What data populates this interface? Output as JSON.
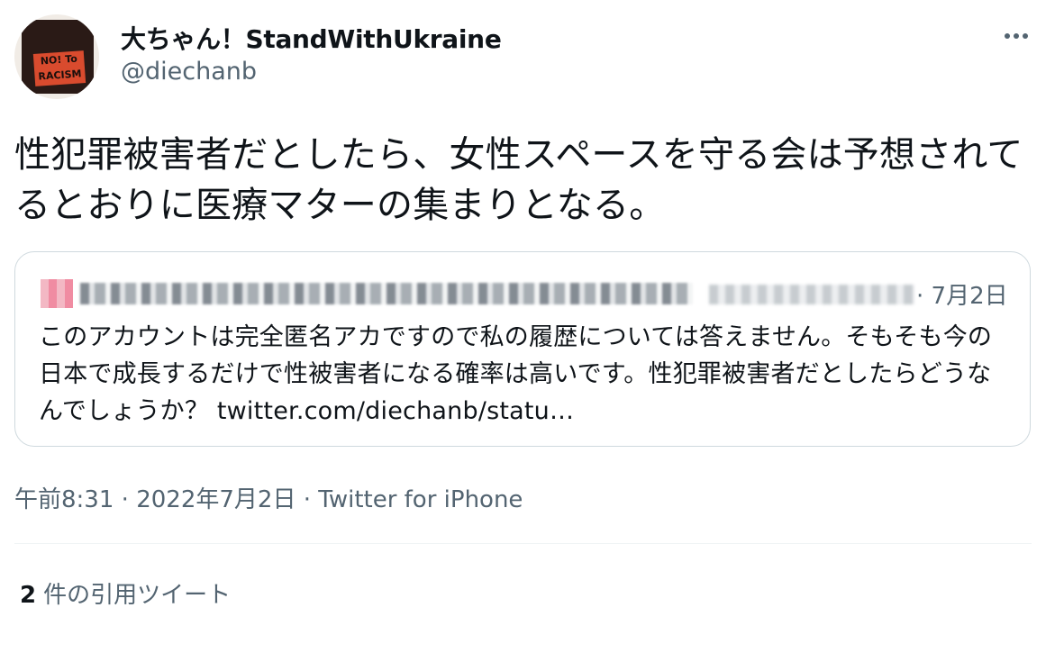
{
  "author": {
    "display_name": "大ちゃん！StandWithUkraine",
    "handle": "@diechanb",
    "avatar_text_line1": "NO! To",
    "avatar_text_line2": "RACISM"
  },
  "tweet": {
    "text": "性犯罪被害者だとしたら、女性スペースを守る会は予想されてるとおりに医療マターの集まりとなる。"
  },
  "quoted_tweet": {
    "date": "· 7月2日",
    "text": "このアカウントは完全匿名アカですので私の履歴については答えません。そもそも今の日本で成長するだけで性被害者になる確率は高いです。性犯罪被害者だとしたらどうなんでしょうか？",
    "link": "twitter.com/diechanb/statu…"
  },
  "meta": {
    "time": "午前8:31",
    "separator1": " · ",
    "date": "2022年7月2日",
    "separator2": " · ",
    "source": "Twitter for iPhone"
  },
  "stats": {
    "quote_count": "2",
    "quote_label": "件の引用ツイート"
  },
  "icons": {
    "more": "more-horizontal-icon"
  },
  "colors": {
    "text": "#0f1419",
    "secondary": "#536471",
    "border": "#cfd9de"
  }
}
